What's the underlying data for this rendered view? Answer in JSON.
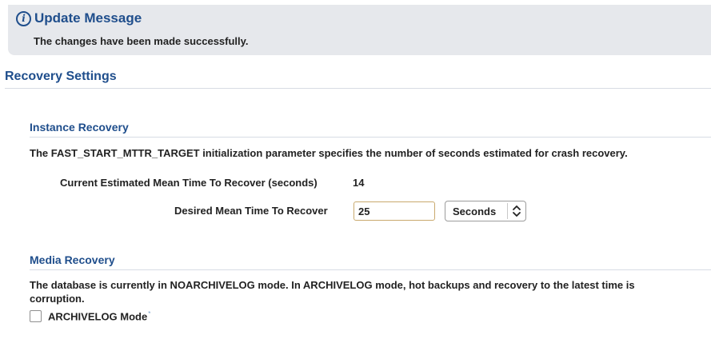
{
  "update_message": {
    "title": "Update Message",
    "body": "The changes have been made successfully.",
    "icon": "info-icon"
  },
  "recovery_settings": {
    "title": "Recovery Settings"
  },
  "instance_recovery": {
    "title": "Instance Recovery",
    "description": "The FAST_START_MTTR_TARGET initialization parameter specifies the number of seconds estimated for crash recovery.",
    "current_estimate_label": "Current Estimated Mean Time To Recover (seconds)",
    "current_estimate_value": "14",
    "desired_label": "Desired Mean Time To Recover",
    "desired_value": "25",
    "unit_selected": "Seconds"
  },
  "media_recovery": {
    "title": "Media Recovery",
    "description_line1": "The database is currently in NOARCHIVELOG mode. In ARCHIVELOG mode, hot backups and recovery to the latest time is",
    "description_line2": "corruption.",
    "archivelog_label": "ARCHIVELOG Mode",
    "archivelog_marker": "*",
    "archivelog_checked": false
  },
  "colors": {
    "heading_blue": "#1f4e8c",
    "banner_bg": "#e6e8ec",
    "rule": "#d7dce4"
  }
}
